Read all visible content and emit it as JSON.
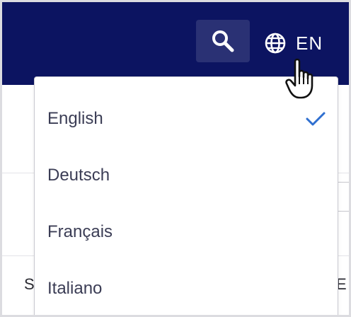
{
  "header": {
    "search_icon": "search-icon",
    "language_icon": "globe-icon",
    "language_code": "EN",
    "colors": {
      "bar_bg": "#0c1461",
      "search_bg": "#2a3174",
      "text": "#ffffff"
    }
  },
  "language_menu": {
    "items": [
      {
        "label": "English",
        "selected": true
      },
      {
        "label": "Deutsch",
        "selected": false
      },
      {
        "label": "Français",
        "selected": false
      },
      {
        "label": "Italiano",
        "selected": false
      }
    ],
    "check_icon": "check-icon",
    "check_color": "#2f6fd0"
  },
  "background": {
    "left_col_char": "S",
    "right_col_char": "E"
  },
  "pointer": "hand-pointer-icon"
}
